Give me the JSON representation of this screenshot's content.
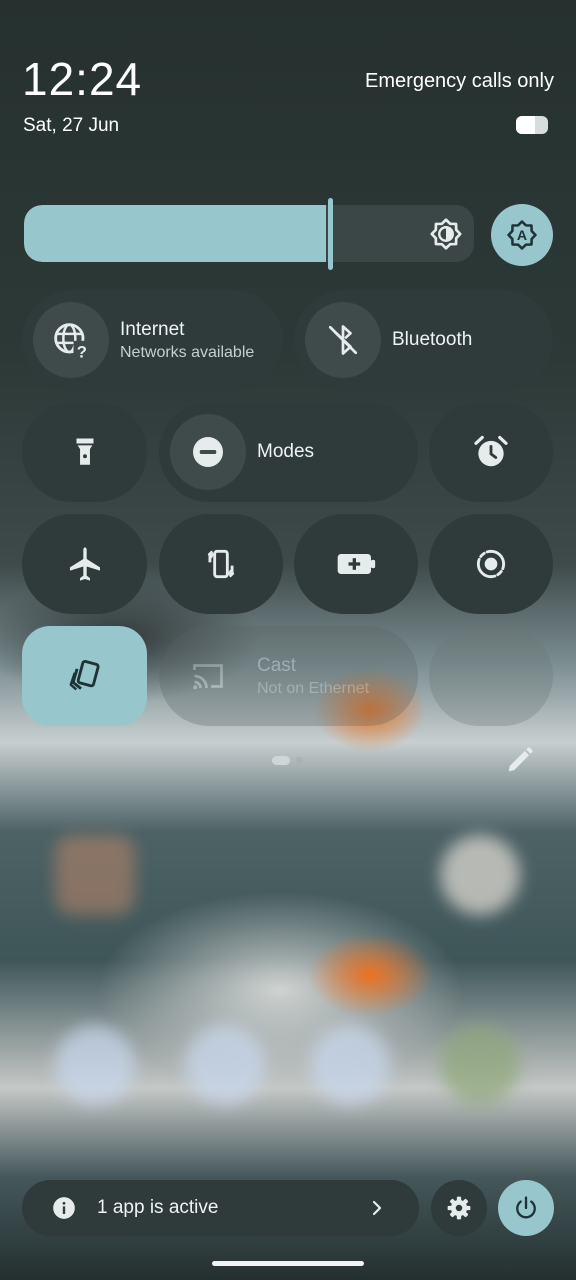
{
  "status_bar": {
    "time": "12:24",
    "date": "Sat, 27 Jun",
    "network_status": "Emergency calls only",
    "battery_level": 0.6
  },
  "brightness": {
    "level": 0.68,
    "icon": "brightness-icon",
    "auto_icon": "auto-brightness-icon"
  },
  "tiles": {
    "internet": {
      "label": "Internet",
      "sub": "Networks available",
      "icon": "globe-question-icon"
    },
    "bluetooth": {
      "label": "Bluetooth",
      "icon": "bluetooth-off-icon"
    },
    "flashlight": {
      "icon": "flashlight-icon"
    },
    "modes": {
      "label": "Modes",
      "icon": "do-not-disturb-icon"
    },
    "alarm": {
      "icon": "alarm-icon"
    },
    "airplane": {
      "icon": "airplane-icon"
    },
    "auto_rotate": {
      "icon": "auto-rotate-icon"
    },
    "battery_saver": {
      "icon": "battery-saver-icon"
    },
    "screen_record": {
      "icon": "screen-record-icon"
    },
    "device_controls": {
      "icon": "cards-icon"
    },
    "cast": {
      "label": "Cast",
      "sub": "Not on Ethernet",
      "icon": "cast-icon"
    }
  },
  "page_indicator": {
    "current": 1,
    "total": 2
  },
  "footer": {
    "active_apps": "1 app is active",
    "info_icon": "info-icon",
    "chevron_icon": "chevron-right-icon",
    "settings_icon": "gear-icon",
    "power_icon": "power-icon"
  },
  "colors": {
    "accent": "#97c6cc",
    "tile_bg": "#2f3a3a",
    "icon_circle": "#3f4a4a"
  }
}
